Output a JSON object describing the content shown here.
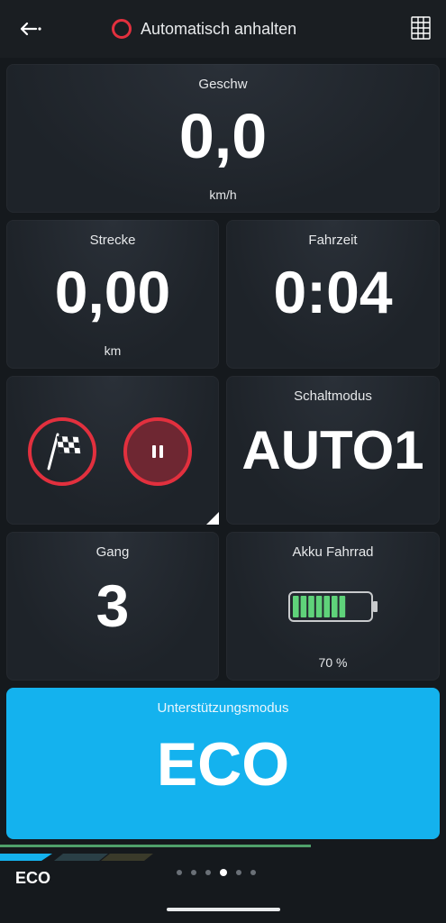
{
  "header": {
    "back_icon": "back-arrow-icon",
    "status_indicator": "red-ring-icon",
    "title": "Automatisch anhalten",
    "layout_icon": "grid-layout-icon"
  },
  "speed": {
    "label": "Geschw",
    "value": "0,0",
    "unit": "km/h"
  },
  "distance": {
    "label": "Strecke",
    "value": "0,00",
    "unit": "km"
  },
  "ride_time": {
    "label": "Fahrzeit",
    "value": "0:04"
  },
  "controls": {
    "finish_icon": "checkered-flag-icon",
    "pause_icon": "pause-icon"
  },
  "shift_mode": {
    "label": "Schaltmodus",
    "value": "AUTO1"
  },
  "gear": {
    "label": "Gang",
    "value": "3"
  },
  "battery": {
    "label": "Akku Fahrrad",
    "value_text": "70 %",
    "level": 0.7,
    "segments_total": 10,
    "color": "#5fd27a"
  },
  "assist": {
    "label": "Unterstützungsmodus",
    "value": "ECO",
    "color": "#14b2ee"
  },
  "footer": {
    "mode": "ECO",
    "pages_total": 6,
    "active_page": 4
  }
}
